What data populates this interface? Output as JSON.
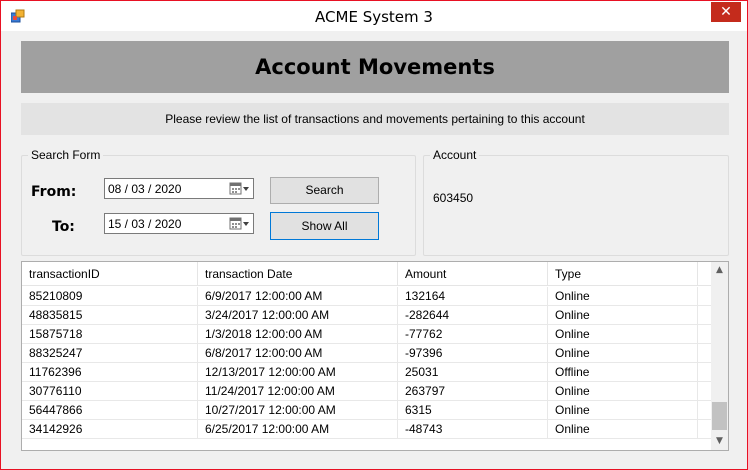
{
  "window": {
    "title": "ACME System 3",
    "close_glyph": "✕"
  },
  "header": {
    "title": "Account Movements"
  },
  "subheader": {
    "text": "Please review the list of transactions and movements pertaining to this account"
  },
  "search_form": {
    "title": "Search Form",
    "from_label": "From:",
    "from_value": "08 / 03 / 2020",
    "to_label": "To:",
    "to_value": "15 / 03 / 2020",
    "search_button": "Search",
    "show_all_button": "Show All"
  },
  "account": {
    "title": "Account",
    "value": "603450"
  },
  "table": {
    "columns": [
      "transactionID",
      "transaction Date",
      "Amount",
      "Type"
    ],
    "rows": [
      [
        "85210809",
        "6/9/2017 12:00:00 AM",
        "132164",
        "Online"
      ],
      [
        "48835815",
        "3/24/2017 12:00:00 AM",
        "-282644",
        "Online"
      ],
      [
        "15875718",
        "1/3/2018 12:00:00 AM",
        "-77762",
        "Online"
      ],
      [
        "88325247",
        "6/8/2017 12:00:00 AM",
        "-97396",
        "Online"
      ],
      [
        "11762396",
        "12/13/2017 12:00:00 AM",
        "25031",
        "Offline"
      ],
      [
        "30776110",
        "11/24/2017 12:00:00 AM",
        "263797",
        "Online"
      ],
      [
        "56447866",
        "10/27/2017 12:00:00 AM",
        "6315",
        "Online"
      ],
      [
        "34142926",
        "6/25/2017 12:00:00 AM",
        "-48743",
        "Online"
      ]
    ]
  },
  "scrollbar": {
    "up_glyph": "▲",
    "down_glyph": "▼"
  },
  "icons": {
    "app": "app-icon",
    "calendar": "calendar-icon",
    "close": "close-icon"
  },
  "colors": {
    "close_button": "#c42b1c",
    "window_border": "#e81123",
    "header_banner": "#a0a0a0",
    "sub_banner": "#e3e3e3",
    "focus_border": "#0078d7"
  }
}
